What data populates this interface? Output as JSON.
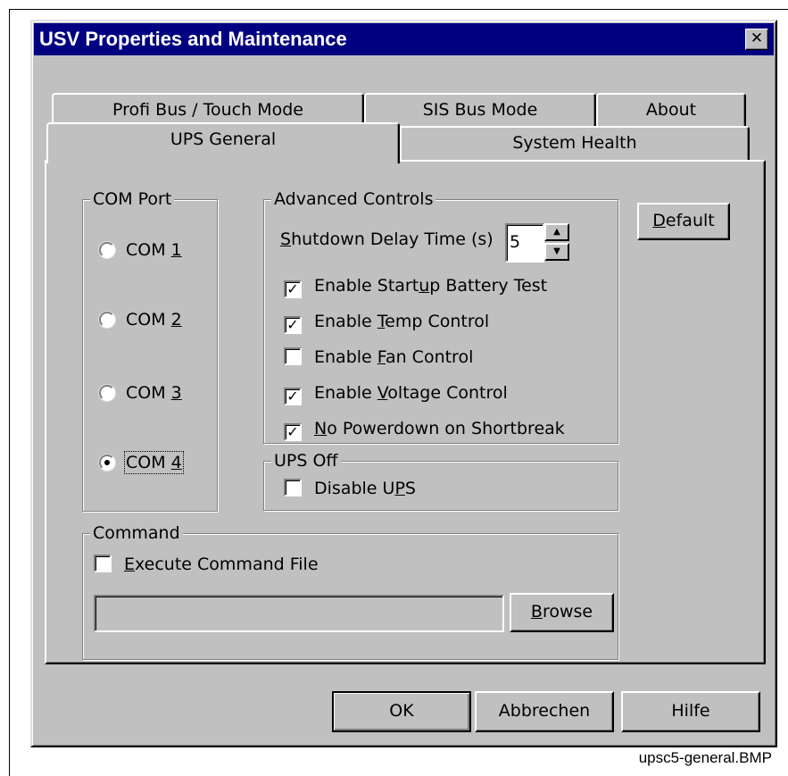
{
  "window": {
    "title": "USV Properties and Maintenance",
    "close_glyph": "✕"
  },
  "tabs": {
    "back": [
      "Profi Bus / Touch Mode",
      "SIS Bus Mode",
      "About"
    ],
    "front": [
      "UPS General",
      "System Health"
    ],
    "active": "UPS General"
  },
  "com_port": {
    "legend": "COM Port",
    "options": [
      {
        "prefix": "COM ",
        "accel": "1",
        "checked": false
      },
      {
        "prefix": "COM ",
        "accel": "2",
        "checked": false
      },
      {
        "prefix": "COM ",
        "accel": "3",
        "checked": false
      },
      {
        "prefix": "COM ",
        "accel": "4",
        "checked": true
      }
    ]
  },
  "advanced": {
    "legend": "Advanced Controls",
    "shutdown": {
      "accel": "S",
      "rest": "hutdown Delay Time (s)",
      "value": "5"
    },
    "checks": [
      {
        "before": "Enable Start",
        "accel": "u",
        "after": "p Battery Test",
        "checked": true
      },
      {
        "before": "Enable ",
        "accel": "T",
        "after": "emp Control",
        "checked": true
      },
      {
        "before": "Enable ",
        "accel": "F",
        "after": "an Control",
        "checked": false
      },
      {
        "before": "Enable ",
        "accel": "V",
        "after": "oltage Control",
        "checked": true
      },
      {
        "before": "",
        "accel": "N",
        "after": "o Powerdown on Shortbreak",
        "checked": true
      }
    ]
  },
  "ups_off": {
    "legend": "UPS Off",
    "check": {
      "before": "Disable U",
      "accel": "P",
      "after": "S",
      "checked": false
    }
  },
  "command": {
    "legend": "Command",
    "check": {
      "before": "",
      "accel": "E",
      "after": "xecute Command File",
      "checked": false
    },
    "path_value": "",
    "browse": {
      "accel": "B",
      "rest": "rowse"
    }
  },
  "default_button": {
    "accel": "D",
    "rest": "efault"
  },
  "footer": {
    "ok": "OK",
    "cancel": "Abbrechen",
    "help": "Hilfe"
  },
  "caption": "upsc5-general.BMP"
}
